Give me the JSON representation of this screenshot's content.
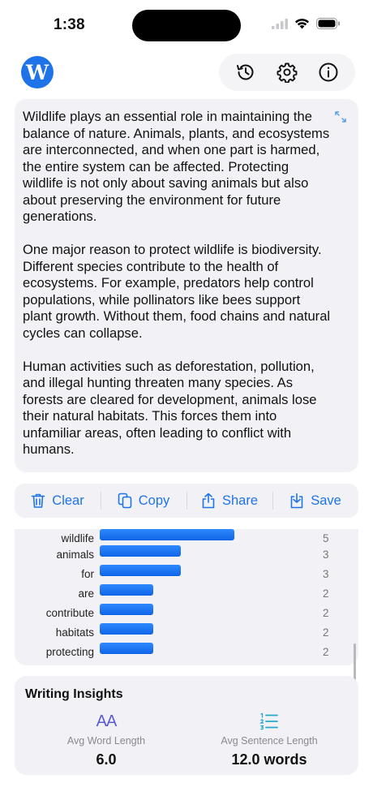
{
  "status": {
    "time": "1:38"
  },
  "header": {
    "logo_letter": "W",
    "actions": [
      "history-icon",
      "gear-icon",
      "info-icon"
    ]
  },
  "text": {
    "paragraphs": [
      "Wildlife plays an essential role in maintaining the balance of nature. Animals, plants, and ecosystems are interconnected, and when one part is harmed, the entire system can be affected. Protecting wildlife is not only about saving animals but also about preserving the environment for future generations.",
      "One major reason to protect wildlife is biodiversity. Different species contribute to the health of ecosystems. For example, predators help control populations, while pollinators like bees support plant growth. Without them, food chains and natural cycles can collapse.",
      "Human activities such as deforestation, pollution, and illegal hunting threaten many species. As forests are cleared for development, animals lose their natural habitats. This forces them into unfamiliar areas, often leading to conflict with humans."
    ]
  },
  "actions": {
    "clear": "Clear",
    "copy": "Copy",
    "share": "Share",
    "save": "Save"
  },
  "word_frequency": {
    "max": 5,
    "items": [
      {
        "word": "wildlife",
        "count": 5
      },
      {
        "word": "animals",
        "count": 3
      },
      {
        "word": "for",
        "count": 3
      },
      {
        "word": "are",
        "count": 2
      },
      {
        "word": "contribute",
        "count": 2
      },
      {
        "word": "habitats",
        "count": 2
      },
      {
        "word": "protecting",
        "count": 2
      }
    ]
  },
  "insights": {
    "title": "Writing Insights",
    "avg_word_label": "Avg Word Length",
    "avg_word_value": "6.0",
    "avg_word_icon_text": "AA",
    "avg_sentence_label": "Avg Sentence Length",
    "avg_sentence_value": "12.0 words"
  },
  "colors": {
    "accent": "#1e73e8",
    "insight_icon": "#5b5bd6",
    "list_icon": "#27a9c9"
  }
}
